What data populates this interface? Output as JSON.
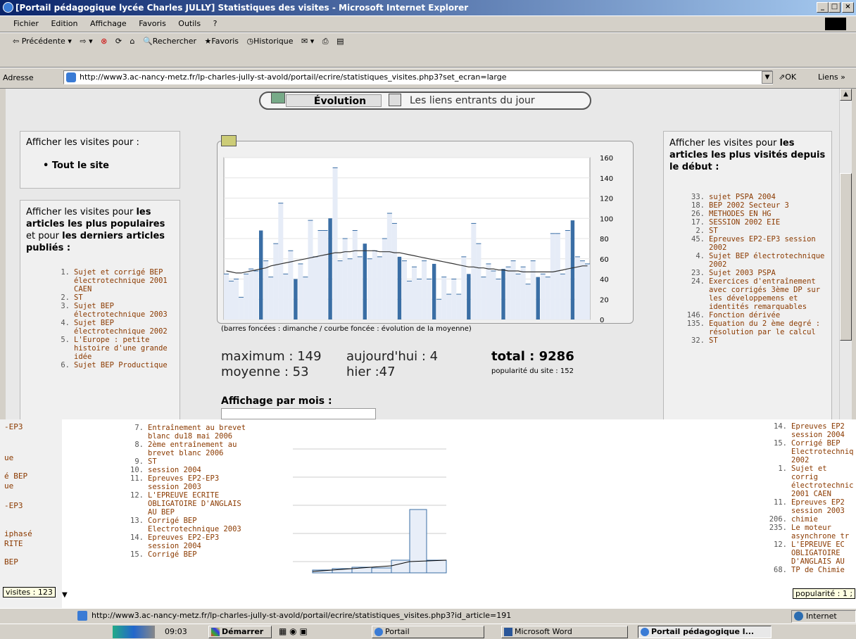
{
  "window": {
    "title": "[Portail pédagogique lycée Charles JULLY] Statistiques des visites - Microsoft Internet Explorer",
    "buttons": [
      "_",
      "□",
      "×"
    ]
  },
  "menu": [
    "Fichier",
    "Edition",
    "Affichage",
    "Favoris",
    "Outils",
    "?"
  ],
  "toolbar": {
    "back": "Précédente",
    "search": "Rechercher",
    "favorites": "Favoris",
    "history": "Historique"
  },
  "address": {
    "label": "Adresse",
    "url": "http://www3.ac-nancy-metz.fr/lp-charles-jully-st-avold/portail/ecrire/statistiques_visites.php3?set_ecran=large",
    "go": "OK",
    "links": "Liens »"
  },
  "tabs": {
    "evolution": "Évolution",
    "incoming": "Les liens entrants du jour"
  },
  "left": {
    "visits_for": "Afficher les visites pour :",
    "whole_site": "Tout le site",
    "popular_prefix": "Afficher les visites pour ",
    "popular_bold1": "les articles les plus populaires",
    "popular_mid": " et pour ",
    "popular_bold2": "les derniers articles publiés :",
    "articles": [
      {
        "n": "1.",
        "t": "Sujet et corrigé BEP électrotechnique 2001 CAEN"
      },
      {
        "n": "2.",
        "t": "ST"
      },
      {
        "n": "3.",
        "t": "Sujet BEP électrotechnique 2003"
      },
      {
        "n": "4.",
        "t": "Sujet BEP électrotechnique 2002"
      },
      {
        "n": "5.",
        "t": "L'Europe : petite histoire d'une grande idée"
      },
      {
        "n": "6.",
        "t": "Sujet BEP Productique"
      }
    ]
  },
  "right": {
    "title_prefix": "Afficher les visites pour ",
    "title_bold": "les articles les plus visités depuis le début :",
    "articles": [
      {
        "n": "33.",
        "t": "sujet PSPA 2004"
      },
      {
        "n": "18.",
        "t": "BEP 2002 Secteur 3"
      },
      {
        "n": "26.",
        "t": "METHODES EN HG"
      },
      {
        "n": "17.",
        "t": "SESSION 2002 EIE"
      },
      {
        "n": "2.",
        "t": "ST"
      },
      {
        "n": "45.",
        "t": "Epreuves EP2-EP3 session 2002"
      },
      {
        "n": "4.",
        "t": "Sujet BEP électrotechnique 2002"
      },
      {
        "n": "23.",
        "t": "Sujet 2003 PSPA"
      },
      {
        "n": "24.",
        "t": "Exercices d'entraînement avec corrigés 3ème DP sur les développemens et identités remarquables"
      },
      {
        "n": "146.",
        "t": "Fonction dérivée"
      },
      {
        "n": "135.",
        "t": "Equation du 2 ème degré : résolution par le calcul"
      },
      {
        "n": "32.",
        "t": "ST"
      }
    ]
  },
  "chart_data": {
    "type": "bar",
    "ylim": [
      0,
      160
    ],
    "yticks": [
      0,
      20,
      40,
      60,
      80,
      100,
      120,
      140,
      160
    ],
    "caption": "(barres foncées : dimanche / courbe foncée : évolution de la moyenne)",
    "values": [
      45,
      38,
      40,
      22,
      45,
      50,
      48,
      88,
      58,
      42,
      75,
      115,
      45,
      68,
      40,
      55,
      42,
      98,
      62,
      88,
      88,
      100,
      150,
      58,
      80,
      60,
      88,
      62,
      75,
      60,
      68,
      62,
      80,
      105,
      95,
      62,
      58,
      38,
      52,
      40,
      58,
      40,
      55,
      20,
      42,
      25,
      40,
      25,
      62,
      45,
      95,
      75,
      42,
      55,
      48,
      40,
      50,
      52,
      58,
      45,
      52,
      35,
      58,
      42,
      45,
      42,
      85,
      85,
      45,
      88,
      98,
      62,
      58,
      55
    ],
    "sundays": [
      7,
      14,
      21,
      28,
      35,
      42,
      49,
      56,
      63,
      70
    ],
    "mean": [
      48,
      47,
      46,
      46,
      47,
      48,
      49,
      50,
      51,
      53,
      54,
      55,
      56,
      57,
      58,
      59,
      60,
      61,
      62,
      63,
      64,
      65,
      66,
      66,
      67,
      67,
      68,
      68,
      68,
      68,
      68,
      67,
      67,
      67,
      66,
      66,
      65,
      64,
      63,
      62,
      61,
      60,
      59,
      58,
      57,
      56,
      55,
      54,
      53,
      52,
      52,
      51,
      51,
      50,
      50,
      49,
      49,
      48,
      48,
      48,
      47,
      47,
      47,
      47,
      47,
      47,
      47,
      48,
      49,
      50,
      51,
      52,
      53,
      53
    ]
  },
  "stats": {
    "maximum": "maximum : 149",
    "moyenne": "moyenne : 53",
    "today": "aujourd'hui : 4",
    "yesterday": "hier :47",
    "total": "total : 9286",
    "popularity": "popularité du site : 152"
  },
  "monthly_title": "Affichage par mois :",
  "overlay": {
    "left_fragments": [
      "-EP3",
      "ue",
      "é BEP",
      "ue",
      "-EP3",
      "iphasé",
      "RITE",
      "BEP"
    ],
    "tooltip_left": "visites : 123",
    "articles": [
      {
        "n": "7.",
        "t": "Entraînement au brevet blanc du18 mai 2006"
      },
      {
        "n": "8.",
        "t": "2ème entraînement au brevet blanc 2006"
      },
      {
        "n": "9.",
        "t": "ST"
      },
      {
        "n": "10.",
        "t": "session 2004"
      },
      {
        "n": "11.",
        "t": "Epreuves EP2-EP3 session 2003"
      },
      {
        "n": "12.",
        "t": "L'EPREUVE ECRITE OBLIGATOIRE D'ANGLAIS AU BEP"
      },
      {
        "n": "13.",
        "t": "Corrigé BEP Electrotechnique 2003"
      },
      {
        "n": "14.",
        "t": "Epreuves EP2-EP3 session 2004"
      },
      {
        "n": "15.",
        "t": "Corrigé BEP"
      }
    ],
    "right_articles": [
      {
        "n": "14.",
        "t": "Epreuves EP2 session 2004"
      },
      {
        "n": "15.",
        "t": "Corrigé BEP Electrotechniq 2002"
      },
      {
        "n": "1.",
        "t": "Sujet et corrig électrotechnic 2001 CAEN"
      },
      {
        "n": "11.",
        "t": "Epreuves EP2 session 2003"
      },
      {
        "n": "206.",
        "t": "chimie"
      },
      {
        "n": "235.",
        "t": "Le moteur asynchrone tr"
      },
      {
        "n": "12.",
        "t": "L'EPREUVE EC OBLIGATOIRE D'ANGLAIS AU"
      },
      {
        "n": "68.",
        "t": "TP de Chimie"
      }
    ],
    "tooltip_right": "popularité : 1 ;"
  },
  "statusbar": {
    "url": "http://www3.ac-nancy-metz.fr/lp-charles-jully-st-avold/portail/ecrire/statistiques_visites.php3?id_article=191",
    "zone": "Internet"
  },
  "taskbar": {
    "start": "Démarrer",
    "clock": "09:03",
    "tasks": [
      "Portail",
      "Microsoft Word",
      "Portail pédagogique l..."
    ]
  }
}
